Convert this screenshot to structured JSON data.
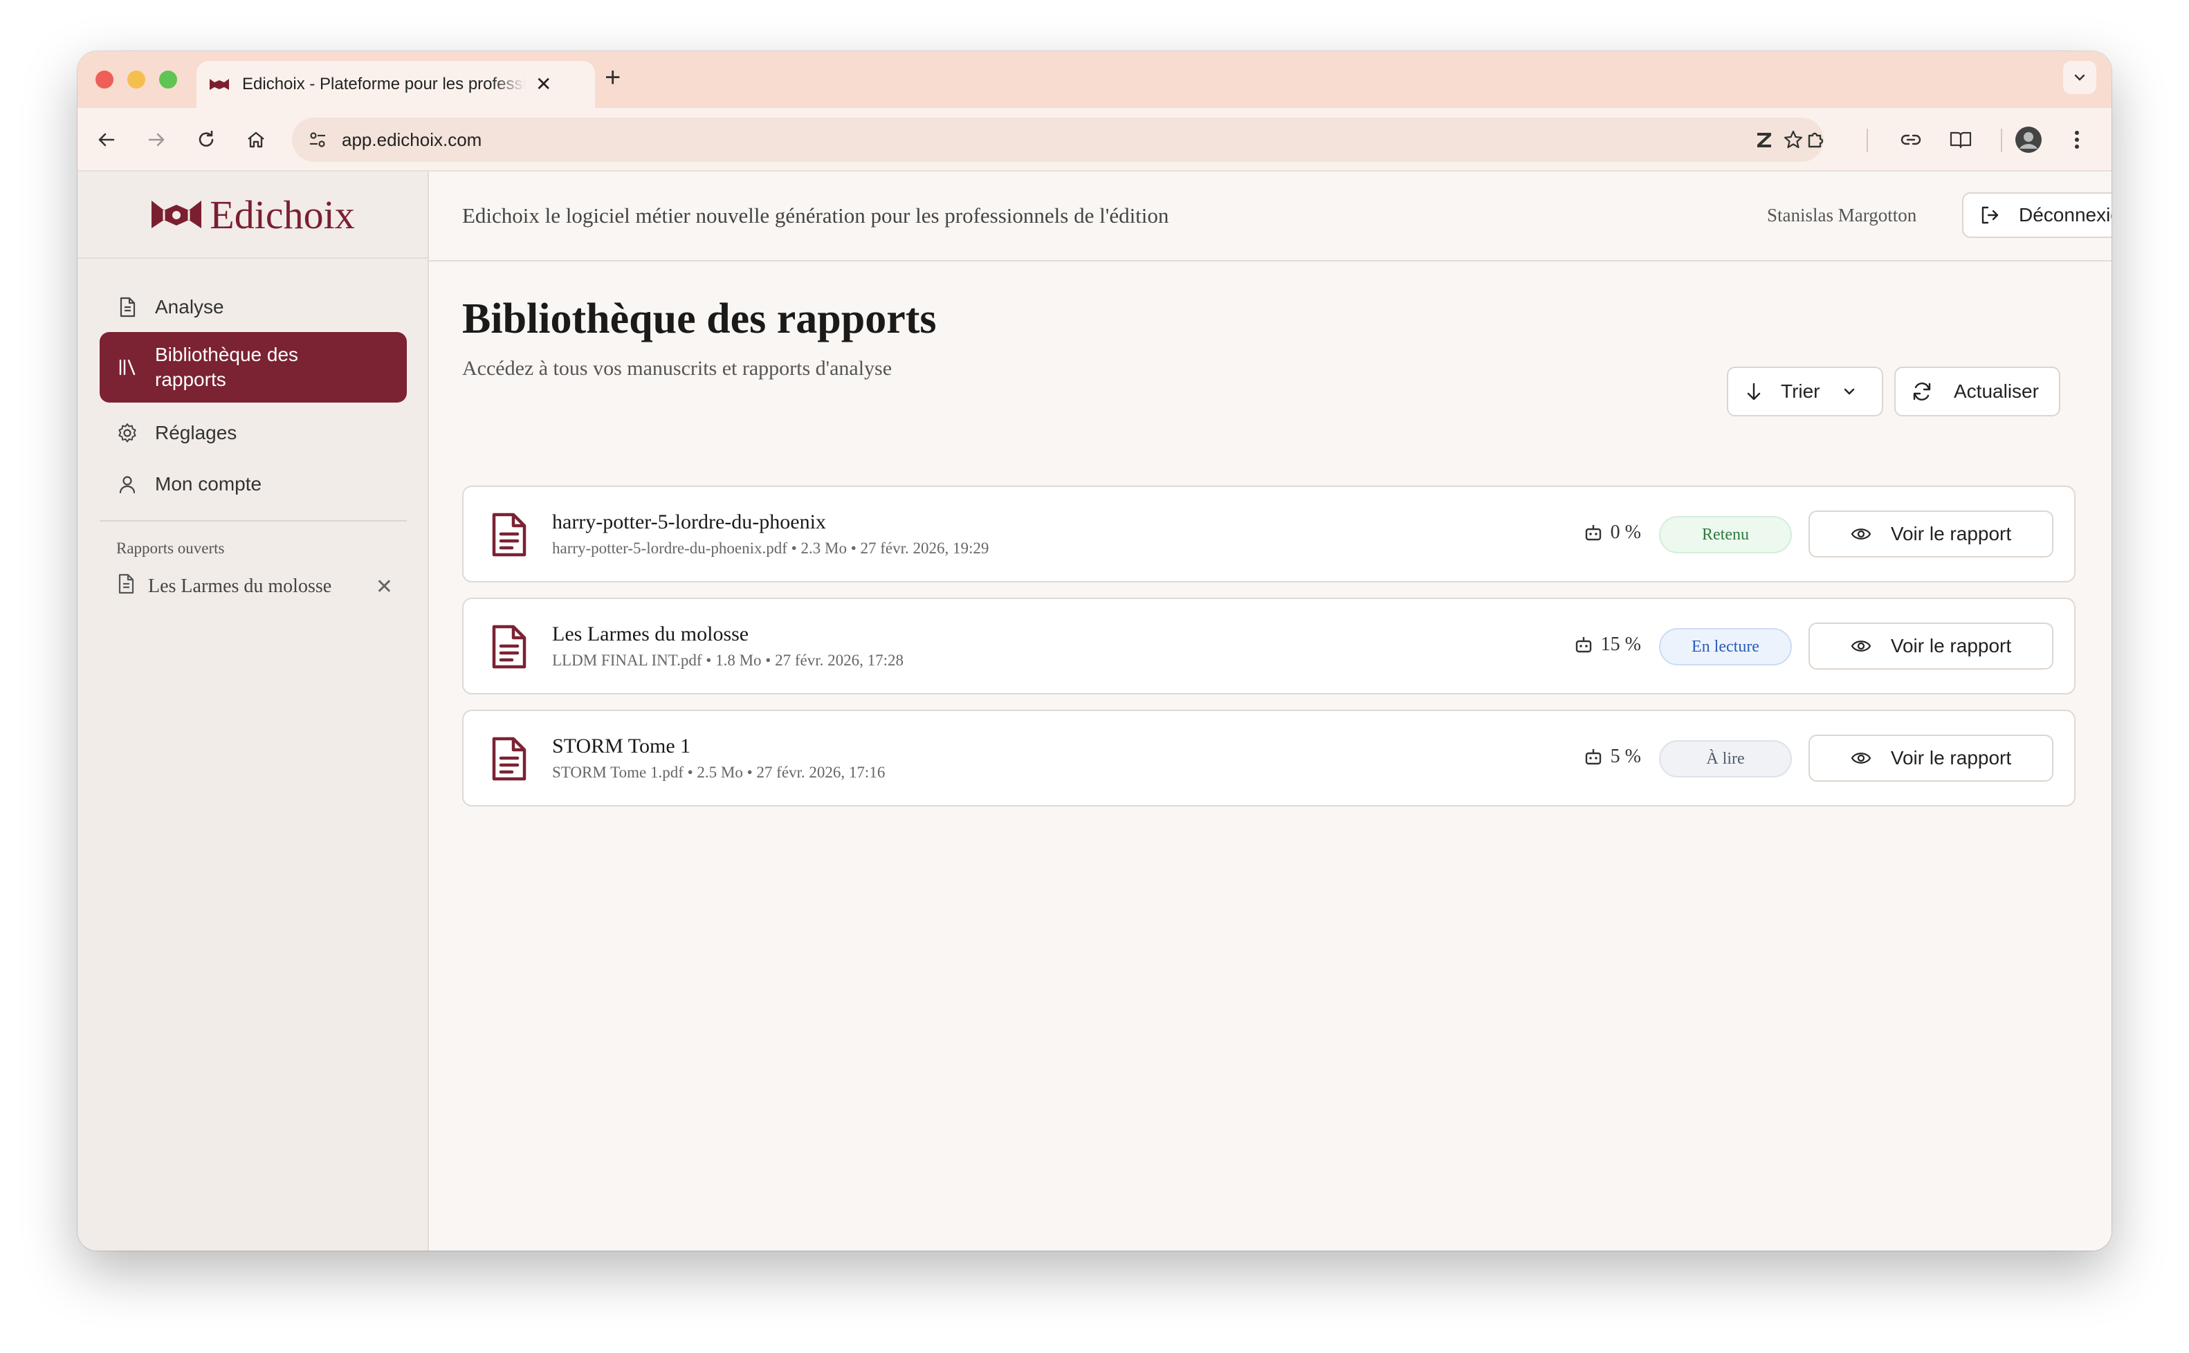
{
  "browser": {
    "tab_title": "Edichoix - Plateforme pour les professionnels de l'édition",
    "tab_close": "✕",
    "new_tab": "+",
    "url": "app.edichoix.com"
  },
  "sidebar": {
    "logo_text": "Edichoix",
    "items": [
      {
        "label": "Analyse",
        "icon": "file-text-icon"
      },
      {
        "label": "Bibliothèque des rapports",
        "icon": "library-icon",
        "active": true
      },
      {
        "label": "Réglages",
        "icon": "gear-icon"
      },
      {
        "label": "Mon compte",
        "icon": "user-icon"
      }
    ],
    "open_reports_title": "Rapports ouverts",
    "open_reports": [
      {
        "label": "Les Larmes du molosse",
        "close": "✕"
      }
    ]
  },
  "header": {
    "tagline": "Edichoix le logiciel métier nouvelle génération pour les professionnels de l'édition",
    "user_name": "Stanislas Margotton",
    "logout_label": "Déconnexion"
  },
  "page": {
    "title": "Bibliothèque des rapports",
    "subtitle": "Accédez à tous vos manuscrits et rapports d'analyse",
    "sort_label": "Trier",
    "refresh_label": "Actualiser"
  },
  "reports": [
    {
      "title": "harry-potter-5-lordre-du-phoenix",
      "meta": "harry-potter-5-lordre-du-phoenix.pdf • 2.3 Mo • 27 févr. 2026, 19:29",
      "ai_percent": "0 %",
      "status": "Retenu",
      "status_color": "green",
      "action_label": "Voir le rapport"
    },
    {
      "title": "Les Larmes du molosse",
      "meta": "LLDM FINAL INT.pdf • 1.8 Mo • 27 févr. 2026, 17:28",
      "ai_percent": "15 %",
      "status": "En lecture",
      "status_color": "blue",
      "action_label": "Voir le rapport"
    },
    {
      "title": "STORM Tome 1",
      "meta": "STORM Tome 1.pdf • 2.5 Mo • 27 févr. 2026, 17:16",
      "ai_percent": "5 %",
      "status": "À lire",
      "status_color": "gray",
      "action_label": "Voir le rapport"
    }
  ],
  "colors": {
    "brand": "#7b2233",
    "tab_strip": "#f8dcd0",
    "background": "#faf6f3"
  }
}
